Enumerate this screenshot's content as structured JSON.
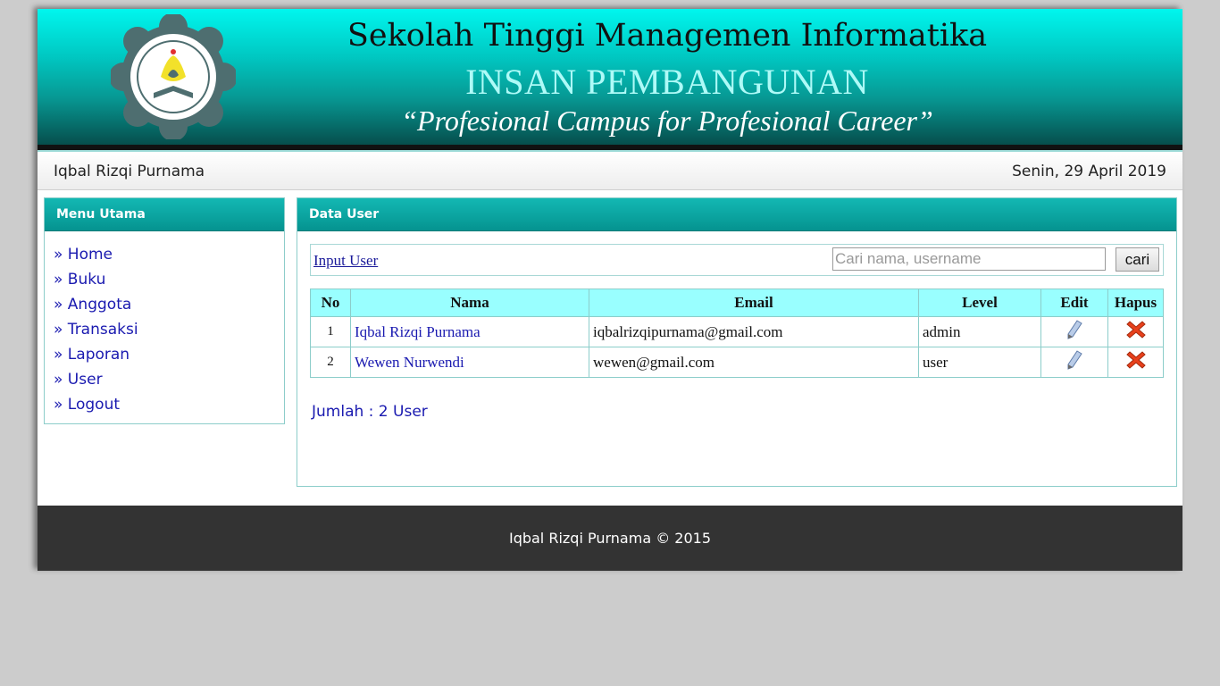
{
  "header": {
    "title": "Sekolah Tinggi Managemen Informatika",
    "subtitle": "INSAN PEMBANGUNAN",
    "slogan": "“Profesional Campus for Profesional Career”",
    "logo_icon": "campus-seal-icon"
  },
  "userbar": {
    "user_name": "Iqbal Rizqi Purnama",
    "date": "Senin, 29 April 2019"
  },
  "sidebar": {
    "title": "Menu Utama",
    "items": [
      {
        "label": "» Home"
      },
      {
        "label": "» Buku"
      },
      {
        "label": "» Anggota"
      },
      {
        "label": "» Transaksi"
      },
      {
        "label": "» Laporan"
      },
      {
        "label": "» User"
      },
      {
        "label": "» Logout"
      }
    ]
  },
  "main": {
    "title": "Data User",
    "input_link": "Input User",
    "search": {
      "placeholder": "Cari nama, username",
      "value": "",
      "button": "cari"
    },
    "table": {
      "headers": [
        "No",
        "Nama",
        "Email",
        "Level",
        "Edit",
        "Hapus"
      ],
      "rows": [
        {
          "no": "1",
          "nama": "Iqbal Rizqi Purnama",
          "email": "iqbalrizqipurnama@gmail.com",
          "level": "admin"
        },
        {
          "no": "2",
          "nama": "Wewen Nurwendi",
          "email": "wewen@gmail.com",
          "level": "user"
        }
      ],
      "edit_icon": "pencil-icon",
      "delete_icon": "red-x-icon"
    },
    "count_text": "Jumlah : 2 User"
  },
  "footer": {
    "text": "Iqbal Rizqi Purnama © 2015"
  },
  "colors": {
    "accent": "#059390",
    "table_header": "#99ffff",
    "link": "#1a1ab0",
    "footer_bg": "#333333"
  }
}
